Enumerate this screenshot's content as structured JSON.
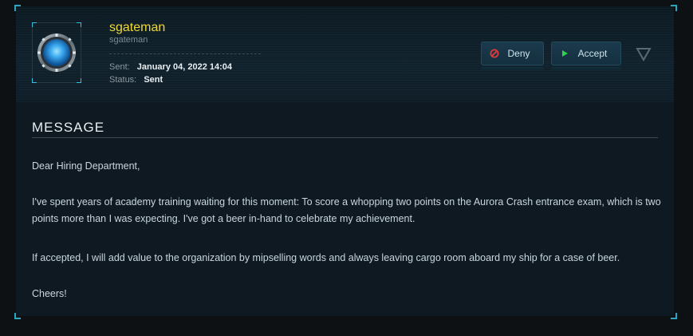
{
  "profile": {
    "name": "sgateman",
    "handle": "sgateman",
    "sent_label": "Sent:",
    "sent_value": "January 04, 2022 14:04",
    "status_label": "Status:",
    "status_value": "Sent"
  },
  "actions": {
    "deny_label": "Deny",
    "accept_label": "Accept",
    "deny_icon": "deny-circle-icon",
    "accept_icon": "play-triangle-icon",
    "expand_icon": "triangle-down-icon"
  },
  "message": {
    "title": "MESSAGE",
    "paragraphs": [
      "Dear Hiring Department,",
      "I've spent years of academy training waiting for this moment: To score a whopping two points on the Aurora Crash entrance exam, which is two points more than I was expecting. I've got a beer in-hand to celebrate my achievement.",
      "If accepted, I will add value to the organization by mipselling words and always leaving cargo room aboard my ship for a case of beer.",
      "Cheers!"
    ]
  },
  "colors": {
    "accent": "#f0d83a",
    "frame_corner": "#2ba6c0",
    "deny_red": "#e23b3b",
    "accept_green": "#2fd24a"
  }
}
